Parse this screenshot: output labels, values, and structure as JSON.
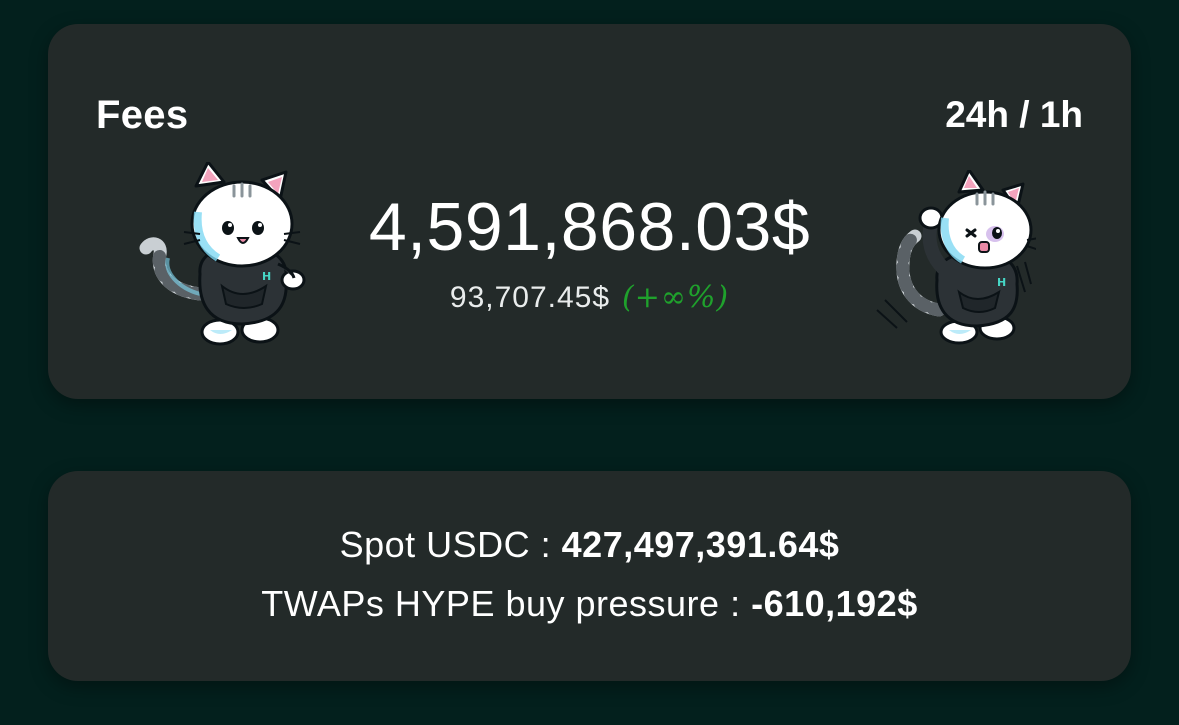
{
  "fees": {
    "title": "Fees",
    "period_toggle": "24h / 1h",
    "total": "4,591,868.03$",
    "period_value": "93,707.45$",
    "period_change": "(+∞%)",
    "change_color": "#1fa12c",
    "left_mascot": "cat-hoodie-waving-icon",
    "right_mascot": "cat-hoodie-scared-icon"
  },
  "stats": {
    "spot_label": "Spot USDC : ",
    "spot_value": "427,497,391.64$",
    "twaps_label": "TWAPs HYPE buy pressure : ",
    "twaps_value": "-610,192$"
  },
  "colors": {
    "background": "#03201d",
    "card": "#232a29",
    "text": "#ffffff",
    "positive": "#1fa12c",
    "mascot_accent": "#7fd8f2"
  }
}
